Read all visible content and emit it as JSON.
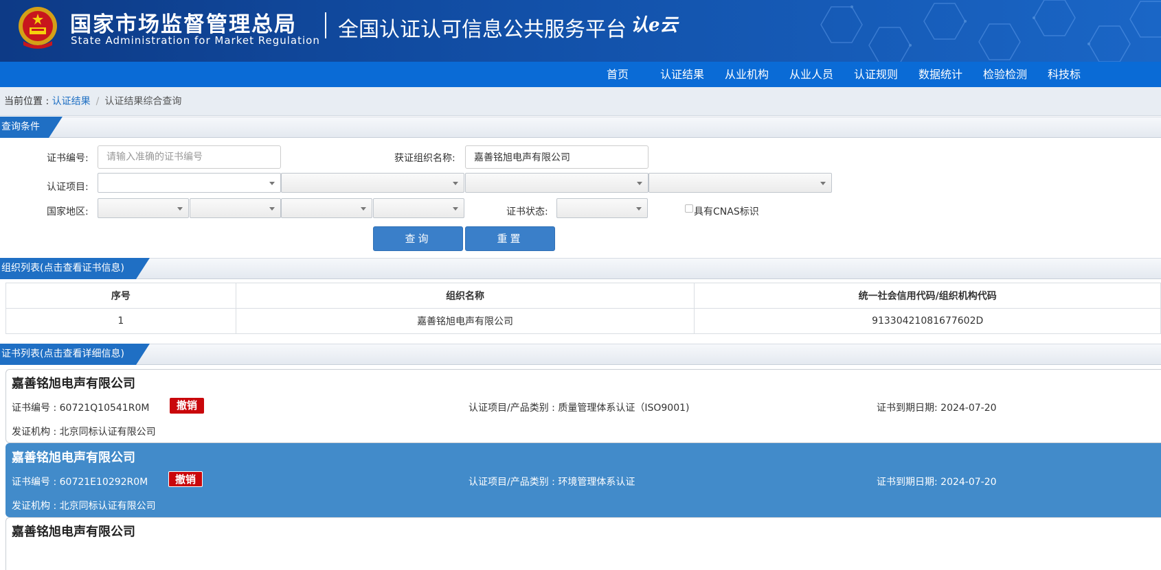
{
  "header": {
    "org_cn": "国家市场监督管理总局",
    "org_en": "State Administration  for  Market Regulation",
    "platform": "全国认证认可信息公共服务平台",
    "logo_text": "认e云"
  },
  "nav": [
    "首页",
    "认证结果",
    "从业机构",
    "从业人员",
    "认证规则",
    "数据统计",
    "检验检测",
    "科技标"
  ],
  "breadcrumb": {
    "prefix": "当前位置 : ",
    "link": "认证结果",
    "separator": "/",
    "current": "认证结果综合查询"
  },
  "query": {
    "section_title": "查询条件",
    "cert_no_label": "证书编号:",
    "cert_no_placeholder": "请输入准确的证书编号",
    "cert_no_value": "",
    "org_name_label": "获证组织名称:",
    "org_name_value": "嘉善铭旭电声有限公司",
    "project_label": "认证项目:",
    "region_label": "国家地区:",
    "status_label": "证书状态:",
    "cnas_label": "具有CNAS标识",
    "cnas_checked": false,
    "search_button": "查询",
    "reset_button": "重置"
  },
  "org_list": {
    "section_title": "组织列表(点击查看证书信息)",
    "columns": [
      "序号",
      "组织名称",
      "统一社会信用代码/组织机构代码"
    ],
    "rows": [
      {
        "index": "1",
        "name": "嘉善铭旭电声有限公司",
        "code": "91330421081677602D"
      }
    ]
  },
  "cert_list": {
    "section_title": "证书列表(点击查看详细信息)",
    "cert_no_prefix": "证书编号 : ",
    "category_prefix": "认证项目/产品类别 : ",
    "expiry_prefix": "证书到期日期: ",
    "issuer_prefix": "发证机构 : ",
    "items": [
      {
        "company": "嘉善铭旭电声有限公司",
        "cert_no": "60721Q10541R0M",
        "status": "撤销",
        "category": "质量管理体系认证（ISO9001)",
        "expiry": "2024-07-20",
        "issuer": "北京同标认证有限公司"
      },
      {
        "company": "嘉善铭旭电声有限公司",
        "cert_no": "60721E10292R0M",
        "status": "撤销",
        "category": "环境管理体系认证",
        "expiry": "2024-07-20",
        "issuer": "北京同标认证有限公司"
      },
      {
        "company": "嘉善铭旭电声有限公司"
      }
    ]
  },
  "colors": {
    "nav_bg": "#0a6bd6",
    "section_tab": "#1f6fc4",
    "button": "#3a7fc9",
    "badge_red": "#c9070b",
    "selected_card": "#428bca"
  }
}
